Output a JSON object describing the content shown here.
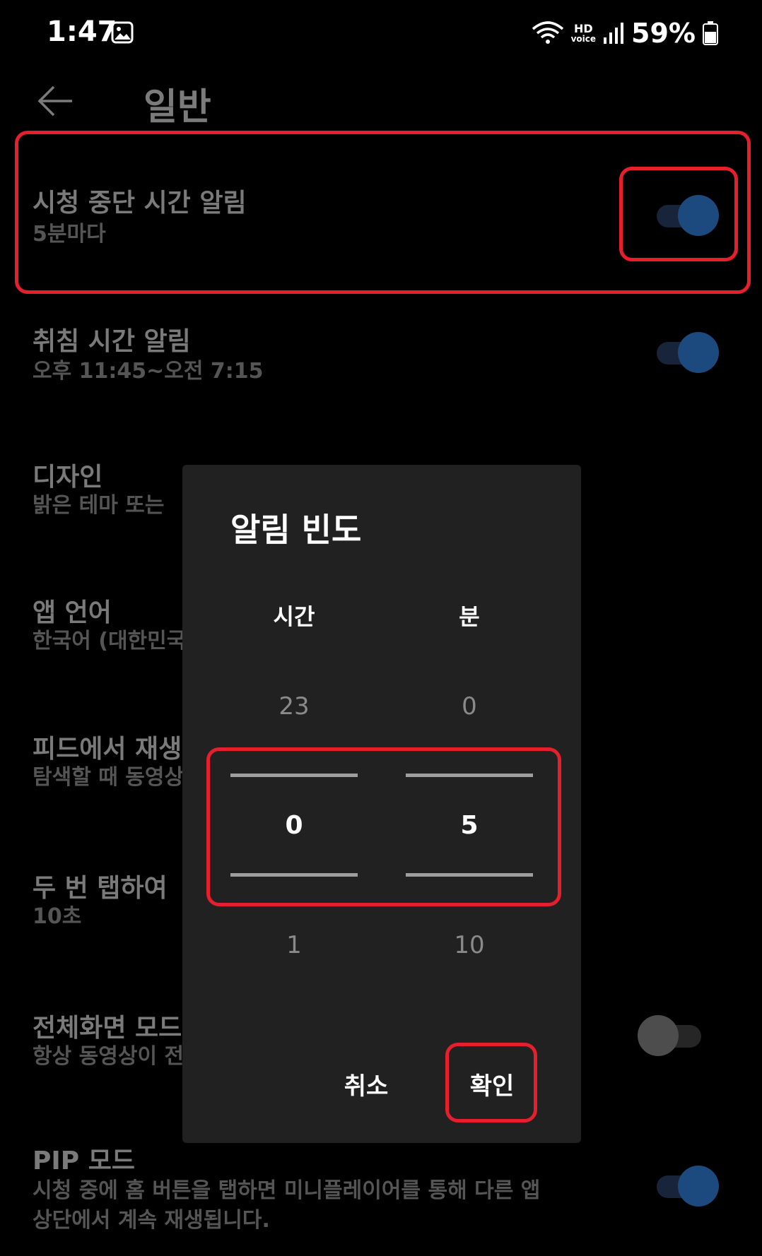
{
  "status_bar": {
    "time": "1:47",
    "hd_line1": "HD",
    "hd_line2": "voice",
    "battery": "59%"
  },
  "header": {
    "title": "일반"
  },
  "settings": [
    {
      "title": "시청 중단 시간 알림",
      "subtitle": "5분마다",
      "toggle": "on"
    },
    {
      "title": "취침 시간 알림",
      "subtitle": "오후 11:45~오전 7:15",
      "toggle": "on"
    },
    {
      "title": "디자인",
      "subtitle": "밝은 테마 또는 "
    },
    {
      "title": "앱 언어",
      "subtitle": "한국어 (대한민국"
    },
    {
      "title": "피드에서 재생",
      "subtitle": "탐색할 때 동영상"
    },
    {
      "title": "두 번 탭하여 ",
      "subtitle": "10초"
    },
    {
      "title": "전체화면 모드",
      "subtitle": "항상 동영상이 전",
      "toggle": "off"
    },
    {
      "title": "PIP 모드",
      "subtitle": "시청 중에 홈 버튼을 탭하면 미니플레이어를 통해 다른 앱",
      "subtitle2": "상단에서 계속 재생됩니다.",
      "toggle": "on"
    }
  ],
  "dialog": {
    "title": "알림 빈도",
    "hours_label": "시간",
    "minutes_label": "분",
    "hours": {
      "prev": "23",
      "selected": "0",
      "next": "1"
    },
    "minutes": {
      "prev": "0",
      "selected": "5",
      "next": "10"
    },
    "cancel": "취소",
    "ok": "확인"
  },
  "colors": {
    "background": "#000000",
    "dialog_bg": "#212121",
    "toggle_on": "#1d4a7e",
    "highlight": "#e5202c"
  }
}
